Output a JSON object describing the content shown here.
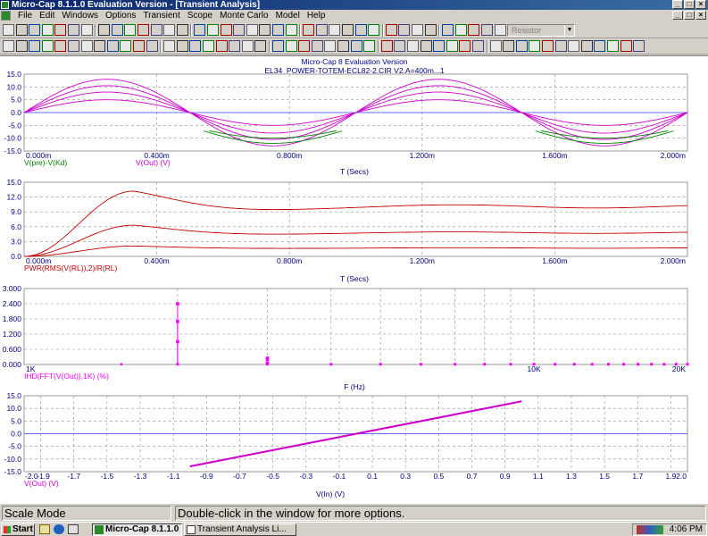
{
  "window": {
    "title": "Micro-Cap 8.1.1.0 Evaluation Version - [Transient Analysis]"
  },
  "menu": [
    "File",
    "Edit",
    "Windows",
    "Options",
    "Transient",
    "Scope",
    "Monte Carlo",
    "Model",
    "Help"
  ],
  "toolbar": {
    "component_combo": "Resistor"
  },
  "plot": {
    "header": "Micro-Cap 8 Evaluation Version",
    "subheader": "EL34_POWER-TOTEM-ECL82-2.CIR V2.A=400m...1",
    "panel1": {
      "y_ticks": [
        "15.0",
        "10.0",
        "5.0",
        "0.0",
        "-5.0",
        "-10.0",
        "-15.0"
      ],
      "x_ticks": [
        "0.000m",
        "0.400m",
        "0.800m",
        "1.200m",
        "1.600m",
        "2.000m"
      ],
      "legend1": "V(pre)-V(Kd)",
      "legend2": "V(Out) (V)",
      "xlabel": "T (Secs)"
    },
    "panel2": {
      "y_ticks": [
        "15.0",
        "12.0",
        "9.0",
        "6.0",
        "3.0",
        "0.0"
      ],
      "x_ticks": [
        "0.000m",
        "0.400m",
        "0.800m",
        "1.200m",
        "1.600m",
        "2.000m"
      ],
      "legend": "PWR(RMS(V(RL)),2)/R(RL)",
      "xlabel": "T (Secs)"
    },
    "panel3": {
      "y_ticks": [
        "3.000",
        "2.400",
        "1.800",
        "1.200",
        "0.600",
        "0.000"
      ],
      "x_ticks": [
        "1K",
        "10K",
        "20K"
      ],
      "legend": "IHD(FFT(V(Out)),1K) (%)",
      "xlabel": "F (Hz)"
    },
    "panel4": {
      "y_ticks": [
        "15.0",
        "10.0",
        "5.0",
        "0.0",
        "-5.0",
        "-10.0",
        "-15.0"
      ],
      "x_ticks": [
        "-2.0",
        "-1.9",
        "-1.7",
        "-1.5",
        "-1.3",
        "-1.1",
        "-0.9",
        "-0.7",
        "-0.5",
        "-0.3",
        "-0.1",
        "0.1",
        "0.3",
        "0.5",
        "0.7",
        "0.9",
        "1.1",
        "1.3",
        "1.5",
        "1.7",
        "1.9",
        "2.0"
      ],
      "legend": "V(Out) (V)",
      "xlabel": "V(In) (V)"
    }
  },
  "chart_data": [
    {
      "type": "line",
      "title": "Micro-Cap 8 Evaluation Version",
      "xlabel": "T (Secs)",
      "xlim": [
        0,
        2
      ],
      "ylim": [
        -15,
        15
      ],
      "series": [
        {
          "name": "V(Out) (V)",
          "color": "#cc00cc",
          "amplitudes": [
            5,
            8,
            10.5,
            13
          ],
          "freq_per_ms": 1
        },
        {
          "name": "V(pre)-V(Kd)",
          "color": "#008000",
          "note": "clipped negative lobes"
        }
      ]
    },
    {
      "type": "line",
      "xlabel": "T (Secs)",
      "xlim": [
        0,
        2
      ],
      "ylim": [
        0,
        15
      ],
      "series": [
        {
          "name": "PWR(RMS(V(RL)),2)/R(RL)",
          "color": "#c00000",
          "steady": [
            1.7,
            4.8,
            10.1
          ],
          "peak": [
            2.1,
            6.3,
            13.2
          ]
        }
      ]
    },
    {
      "type": "bar",
      "xlabel": "F (Hz)",
      "xlim": [
        1000,
        20000
      ],
      "ylim": [
        0,
        3
      ],
      "xscale": "log",
      "series": [
        {
          "name": "IHD(FFT(V(Out)),1K) (%)",
          "color": "#ff00ff",
          "x": [
            2000,
            2000,
            2000,
            3000,
            3000,
            3000
          ],
          "values": [
            2.4,
            1.7,
            0.9,
            0.05,
            0.2,
            0.25
          ]
        }
      ]
    },
    {
      "type": "line",
      "xlabel": "V(In) (V)",
      "xlim": [
        -2,
        2
      ],
      "ylim": [
        -15,
        15
      ],
      "series": [
        {
          "name": "V(Out) (V)",
          "color": "#cc00cc",
          "x": [
            -1.0,
            1.0
          ],
          "values": [
            -12.7,
            13.0
          ]
        }
      ]
    }
  ],
  "status": {
    "mode": "Scale Mode",
    "hint": "Double-click in the window for more options."
  },
  "taskbar": {
    "start": "Start",
    "task1": "Micro-Cap 8.1.1.0 ...",
    "task2": "Transient Analysis Li...",
    "clock": "4:06 PM"
  }
}
